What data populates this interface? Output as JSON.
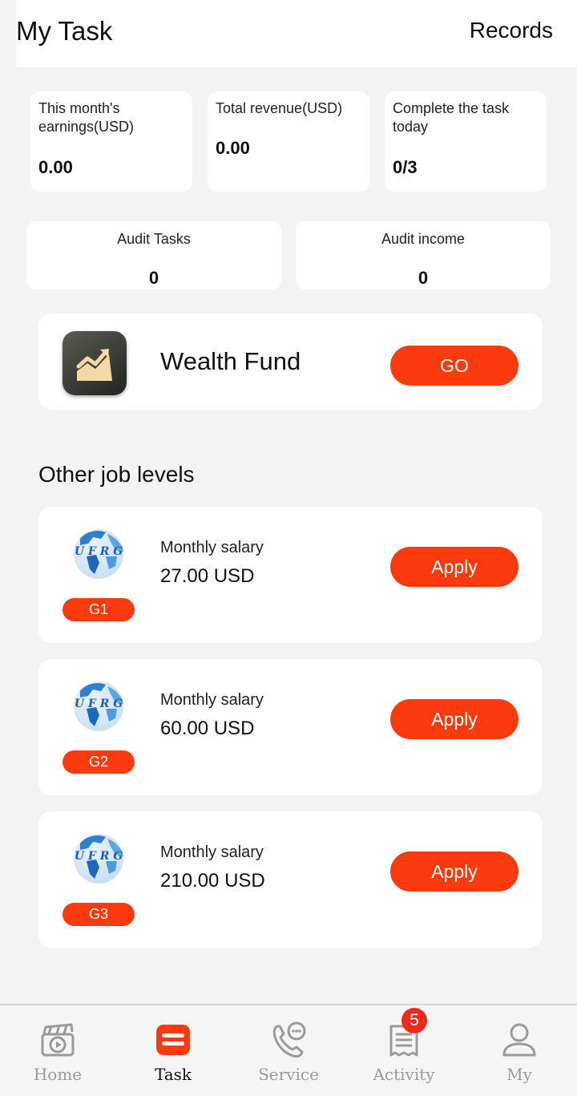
{
  "header": {
    "title": "My Task",
    "records_label": "Records"
  },
  "stats": [
    {
      "label": "This month's earnings(USD)",
      "value": "0.00"
    },
    {
      "label": "Total revenue(USD)",
      "value": "0.00"
    },
    {
      "label": "Complete the task today",
      "value": "0/3"
    }
  ],
  "audit": [
    {
      "label": "Audit Tasks",
      "value": "0"
    },
    {
      "label": "Audit income",
      "value": "0"
    }
  ],
  "fund": {
    "name": "Wealth Fund",
    "button_label": "GO",
    "icon": "chart-up-icon"
  },
  "other_levels": {
    "title": "Other job levels",
    "logo_text": "U F R G",
    "items": [
      {
        "grade": "G1",
        "salary_label": "Monthly salary",
        "salary_value": "27.00 USD",
        "button_label": "Apply"
      },
      {
        "grade": "G2",
        "salary_label": "Monthly salary",
        "salary_value": "60.00 USD",
        "button_label": "Apply"
      },
      {
        "grade": "G3",
        "salary_label": "Monthly salary",
        "salary_value": "210.00 USD",
        "button_label": "Apply"
      }
    ]
  },
  "tabbar": {
    "items": [
      {
        "label": "Home",
        "icon": "clapperboard-icon"
      },
      {
        "label": "Task",
        "icon": "task-icon",
        "active": true
      },
      {
        "label": "Service",
        "icon": "phone-chat-icon"
      },
      {
        "label": "Activity",
        "icon": "receipt-icon",
        "badge": "5"
      },
      {
        "label": "My",
        "icon": "user-icon"
      }
    ]
  },
  "colors": {
    "accent": "#fc3a0d",
    "background": "#f3f3f3",
    "card": "#ffffff",
    "badge": "#f02a1a"
  }
}
